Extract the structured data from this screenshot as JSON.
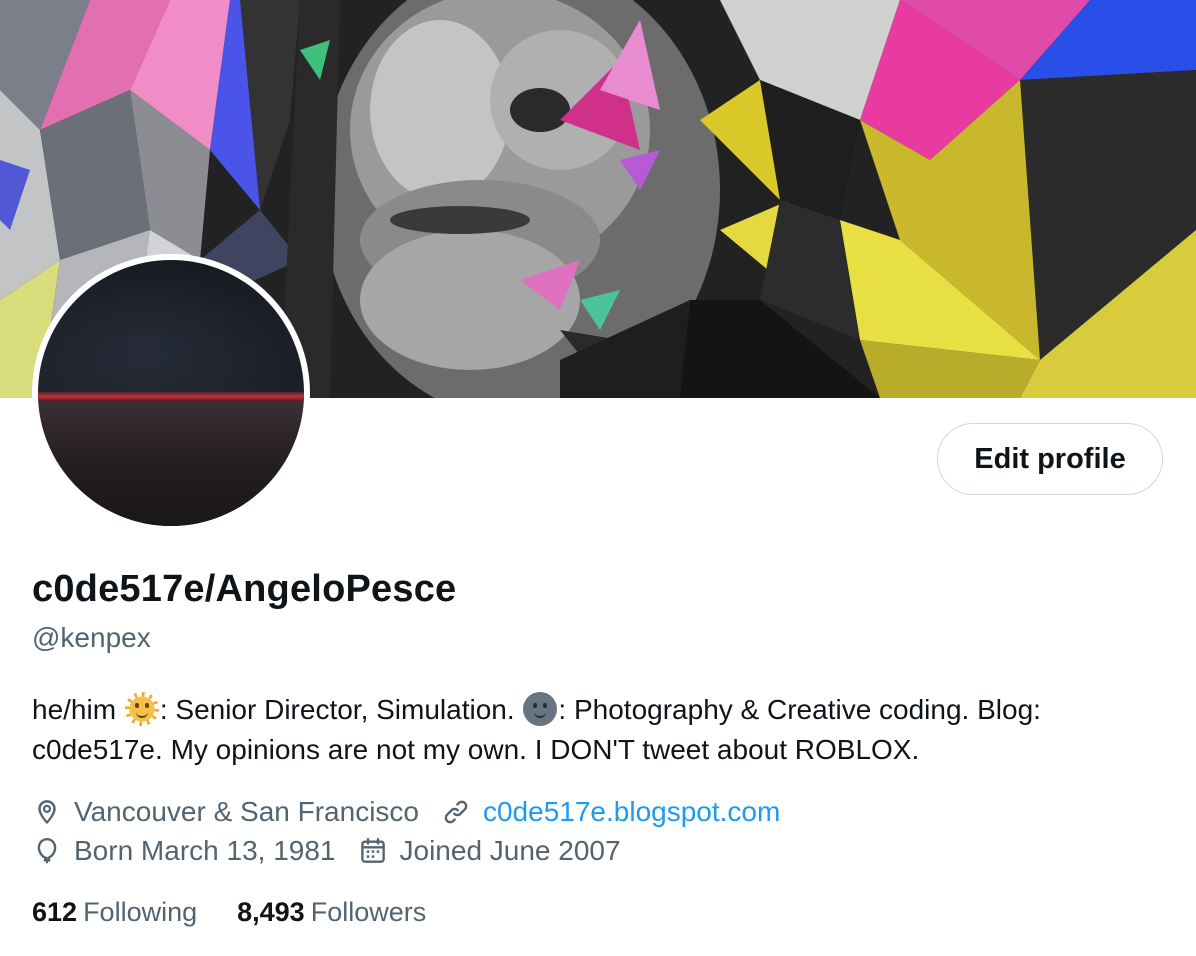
{
  "profile": {
    "display_name": "c0de517e/AngeloPesce",
    "handle": "@kenpex",
    "edit_button_label": "Edit profile",
    "bio": {
      "part1": "he/him ",
      "part2": ": Senior Director, Simulation. ",
      "part3": ": Photography & Creative coding. Blog: c0de517e. My opinions are not my own. I DON'T tweet about ROBLOX."
    },
    "location": "Vancouver & San Francisco",
    "website": "c0de517e.blogspot.com",
    "birthday": "Born March 13, 1981",
    "joined": "Joined June 2007",
    "following_count": "612",
    "following_label": "Following",
    "followers_count": "8,493",
    "followers_label": "Followers"
  },
  "icons": {
    "location": "location-pin-icon",
    "website": "link-icon",
    "birthday": "balloon-icon",
    "joined": "calendar-icon",
    "bio_emoji_1": "sun-with-face-emoji",
    "bio_emoji_2": "new-moon-face-emoji"
  },
  "colors": {
    "text_primary": "#0f1419",
    "text_secondary": "#536471",
    "link": "#1d9bf0",
    "button_border": "#cfd9de"
  }
}
